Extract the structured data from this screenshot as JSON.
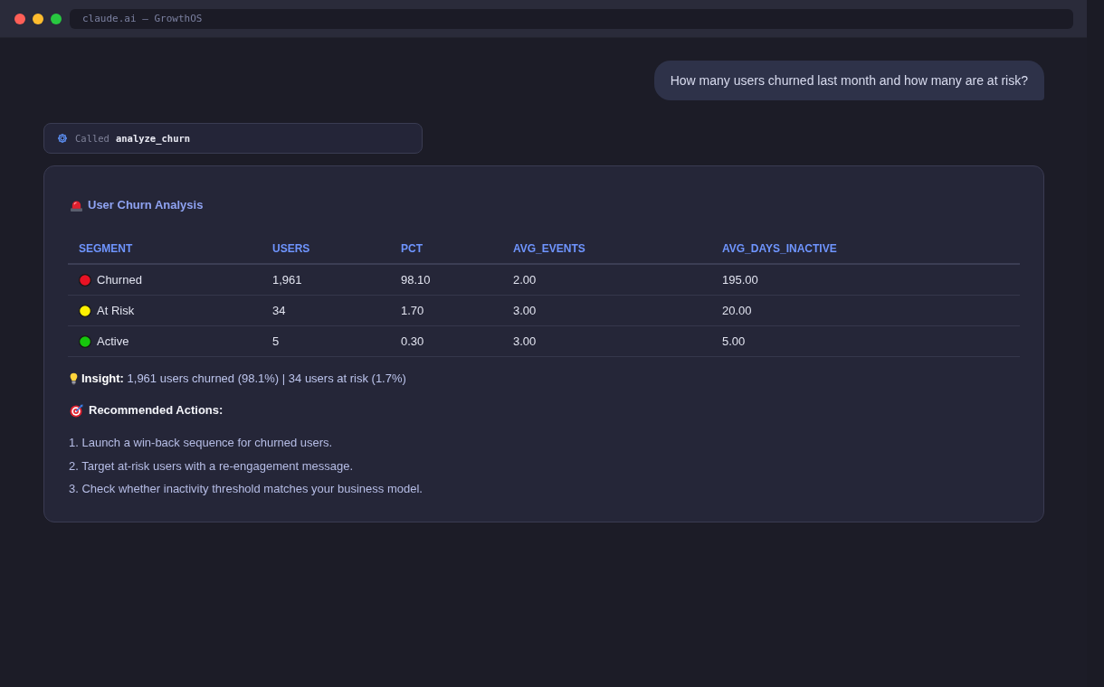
{
  "window": {
    "address": "claude.ai — GrowthOS"
  },
  "user_message": {
    "text": "How many users churned last month and how many are at risk?"
  },
  "tool_call": {
    "label": "Called",
    "name": "analyze_churn"
  },
  "result": {
    "title": "User Churn Analysis",
    "table": {
      "columns": [
        "SEGMENT",
        "USERS",
        "PCT",
        "AVG_EVENTS",
        "AVG_DAYS_INACTIVE"
      ],
      "rows": [
        {
          "color": "#e81224",
          "cells": [
            "Churned",
            "1,961",
            "98.10",
            "2.00",
            "195.00"
          ]
        },
        {
          "color": "#fff100",
          "cells": [
            "At Risk",
            "34",
            "1.70",
            "3.00",
            "20.00"
          ]
        },
        {
          "color": "#16c60c",
          "cells": [
            "Active",
            "5",
            "0.30",
            "3.00",
            "5.00"
          ]
        }
      ]
    },
    "insight": "**Insight:** 1,961 users churned (98.1%) | 34 users at risk (1.7%)",
    "actions_heading": "Recommended Actions:",
    "actions": [
      "1. Launch a win-back sequence for churned users.",
      "2. Target at-risk users with a re-engagement message.",
      "3. Check whether inactivity threshold matches your business model."
    ]
  }
}
